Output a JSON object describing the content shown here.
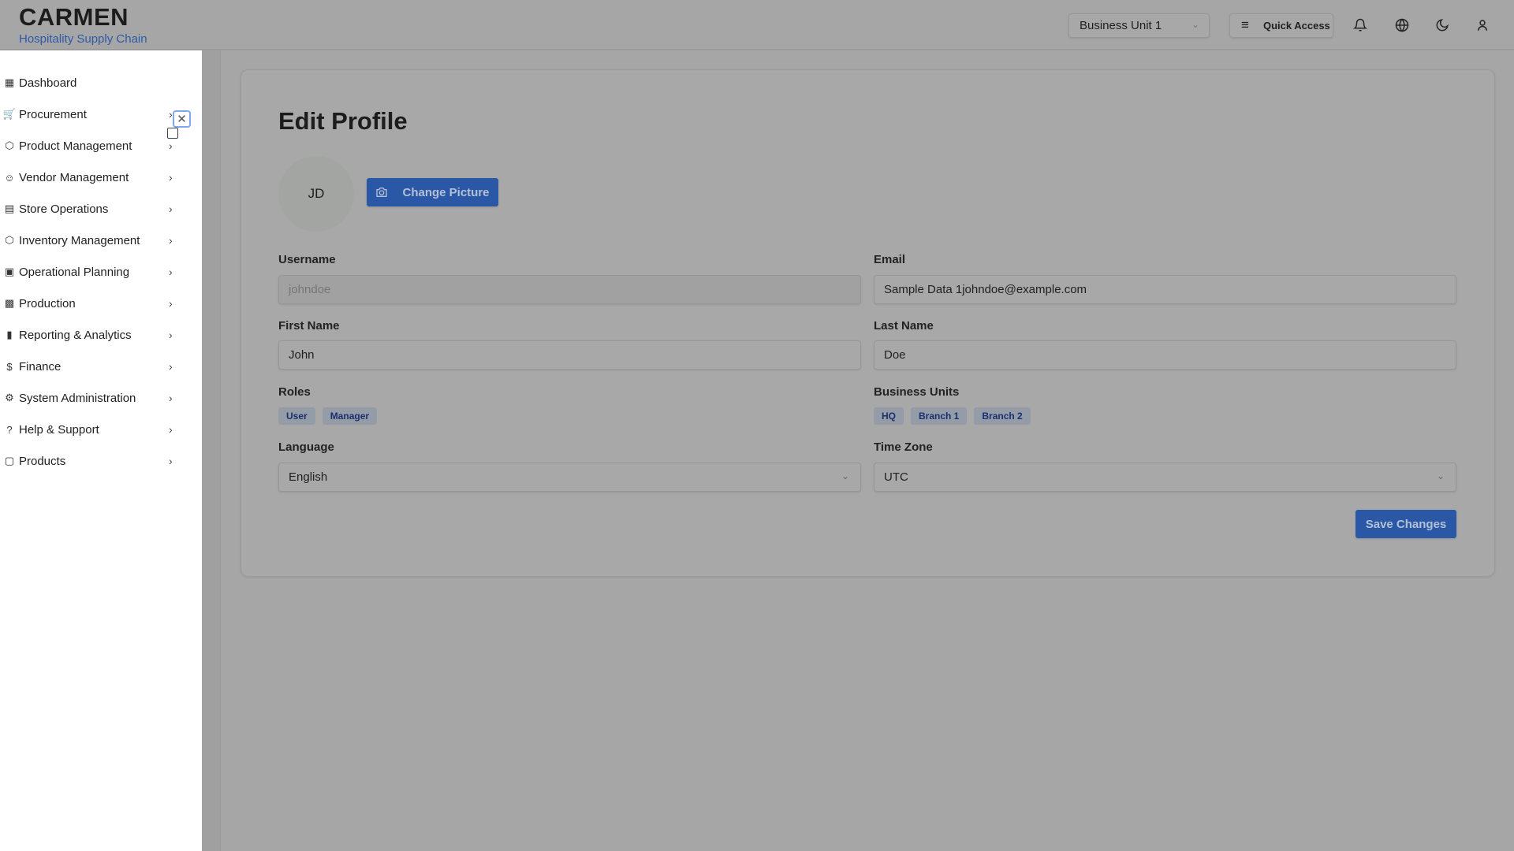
{
  "header": {
    "brand": "CARMEN",
    "subtitle": "Hospitality Supply Chain",
    "business_unit": "Business Unit 1",
    "quick_access": "Quick Access"
  },
  "sidebar": {
    "items": [
      {
        "label": "Dashboard",
        "icon": "dashboard-icon"
      },
      {
        "label": "Procurement",
        "icon": "cart-icon"
      },
      {
        "label": "Product Management",
        "icon": "package-icon"
      },
      {
        "label": "Vendor Management",
        "icon": "users-icon"
      },
      {
        "label": "Store Operations",
        "icon": "store-icon"
      },
      {
        "label": "Inventory Management",
        "icon": "package-icon"
      },
      {
        "label": "Operational Planning",
        "icon": "calendar-icon"
      },
      {
        "label": "Production",
        "icon": "factory-icon"
      },
      {
        "label": "Reporting & Analytics",
        "icon": "bar-chart-icon"
      },
      {
        "label": "Finance",
        "icon": "dollar-icon"
      },
      {
        "label": "System Administration",
        "icon": "gear-icon"
      },
      {
        "label": "Help & Support",
        "icon": "help-icon"
      },
      {
        "label": "Products",
        "icon": "box-icon"
      }
    ]
  },
  "profile": {
    "title": "Edit Profile",
    "initials": "JD",
    "change_picture": "Change Picture",
    "username_label": "Username",
    "username": "johndoe",
    "email_label": "Email",
    "email": "Sample Data 1johndoe@example.com",
    "first_name_label": "First Name",
    "first_name": "John",
    "last_name_label": "Last Name",
    "last_name": "Doe",
    "roles_label": "Roles",
    "roles": [
      "User",
      "Manager"
    ],
    "bu_label": "Business Units",
    "business_units": [
      "HQ",
      "Branch 1",
      "Branch 2"
    ],
    "language_label": "Language",
    "language": "English",
    "timezone_label": "Time Zone",
    "timezone": "UTC",
    "save": "Save Changes"
  },
  "colors": {
    "primary": "#2a58a6",
    "subtitle": "#2d5aa6"
  }
}
